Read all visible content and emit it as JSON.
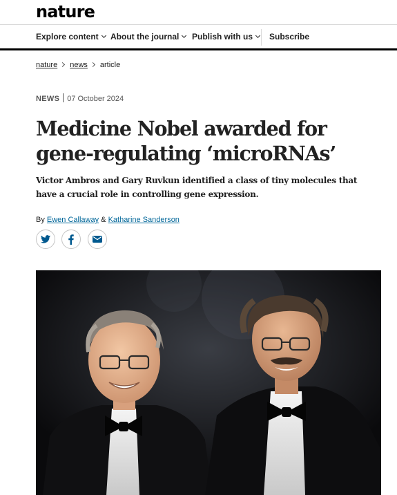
{
  "header": {
    "logo": "nature"
  },
  "nav": {
    "items": [
      {
        "label": "Explore content",
        "dropdown": true
      },
      {
        "label": "About the journal",
        "dropdown": true
      },
      {
        "label": "Publish with us",
        "dropdown": true
      },
      {
        "label": "Subscribe",
        "dropdown": false
      }
    ]
  },
  "breadcrumb": {
    "items": [
      {
        "label": "nature",
        "link": true
      },
      {
        "label": "news",
        "link": true
      },
      {
        "label": "article",
        "link": false
      }
    ]
  },
  "article": {
    "type": "NEWS",
    "date": "07 October 2024",
    "title": "Medicine Nobel awarded for gene-regulating ‘microRNAs’",
    "standfirst": "Victor Ambros and Gary Ruvkun identified a class of tiny molecules that have a crucial role in controlling gene expression.",
    "byline_prefix": "By",
    "authors": [
      "Ewen Callaway",
      "Katharine Sanderson"
    ],
    "author_joiner": "&"
  },
  "share": {
    "icons": [
      "twitter-icon",
      "facebook-icon",
      "email-icon"
    ],
    "icon_color": "#00598f"
  },
  "colors": {
    "link": "#006699",
    "text": "#222222",
    "meta": "#555555",
    "nav_underline": "#000000"
  }
}
